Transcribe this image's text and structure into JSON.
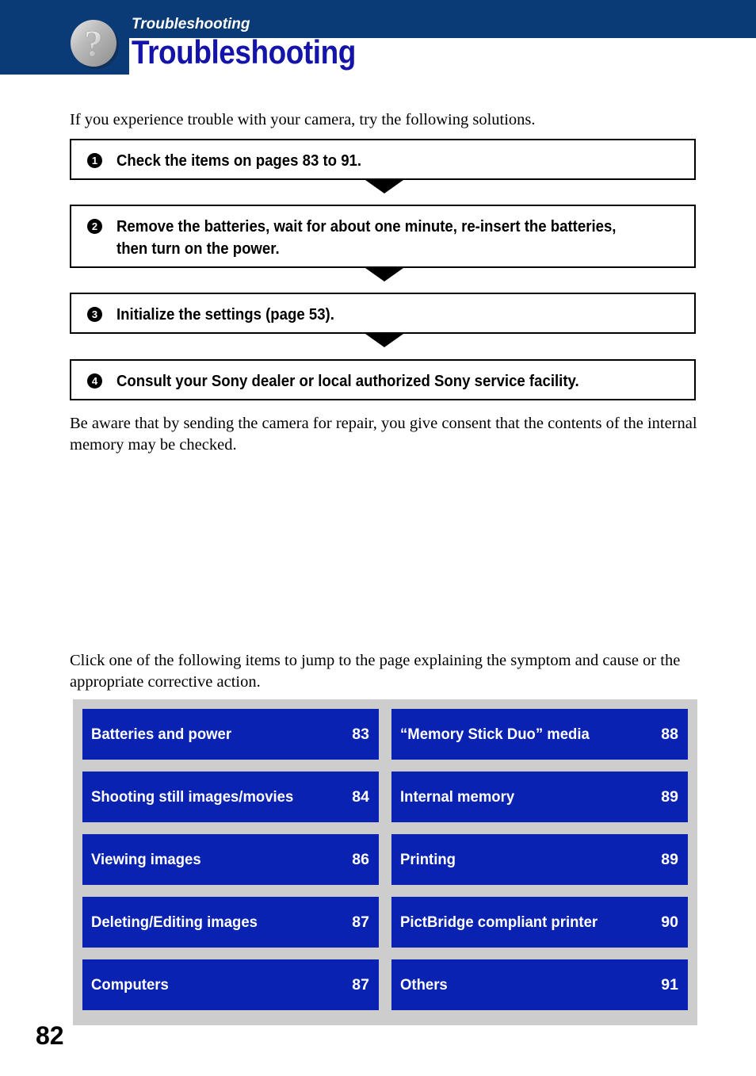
{
  "header": {
    "kicker": "Troubleshooting",
    "title": "Troubleshooting",
    "icon": "question-mark-circle-icon",
    "bar_color": "#0a3b77",
    "title_color": "#1414a8"
  },
  "intro": {
    "paragraph": "If you experience trouble with your camera, try the following solutions."
  },
  "steps": [
    {
      "number": "1",
      "text": "Check the items on pages 83 to 91."
    },
    {
      "number": "2",
      "text": "Remove the batteries, wait for about one minute, re-insert the batteries, then turn on the power."
    },
    {
      "number": "3",
      "text": "Initialize the settings (page 53)."
    },
    {
      "number": "4",
      "text": "Consult your Sony dealer or local authorized Sony service facility."
    }
  ],
  "repair_note": {
    "paragraph": "Be aware that by sending the camera for repair, you give consent that the contents of the internal memory may be checked."
  },
  "click_note": {
    "paragraph": "Click one of the following items to jump to the page explaining the symptom and cause or the appropriate corrective action."
  },
  "link_grid": {
    "background_color": "#cdcdcd",
    "button_color": "#0a22b2",
    "items": [
      {
        "label": "Batteries and power",
        "page": "83"
      },
      {
        "label": "“Memory Stick Duo” media",
        "page": "88"
      },
      {
        "label": "Shooting still images/movies",
        "page": "84"
      },
      {
        "label": "Internal memory",
        "page": "89"
      },
      {
        "label": "Viewing images",
        "page": "86"
      },
      {
        "label": "Printing",
        "page": "89"
      },
      {
        "label": "Deleting/Editing images",
        "page": "87"
      },
      {
        "label": "PictBridge compliant printer",
        "page": "90"
      },
      {
        "label": "Computers",
        "page": "87"
      },
      {
        "label": "Others",
        "page": "91"
      }
    ]
  },
  "footer": {
    "page_number": "82"
  }
}
